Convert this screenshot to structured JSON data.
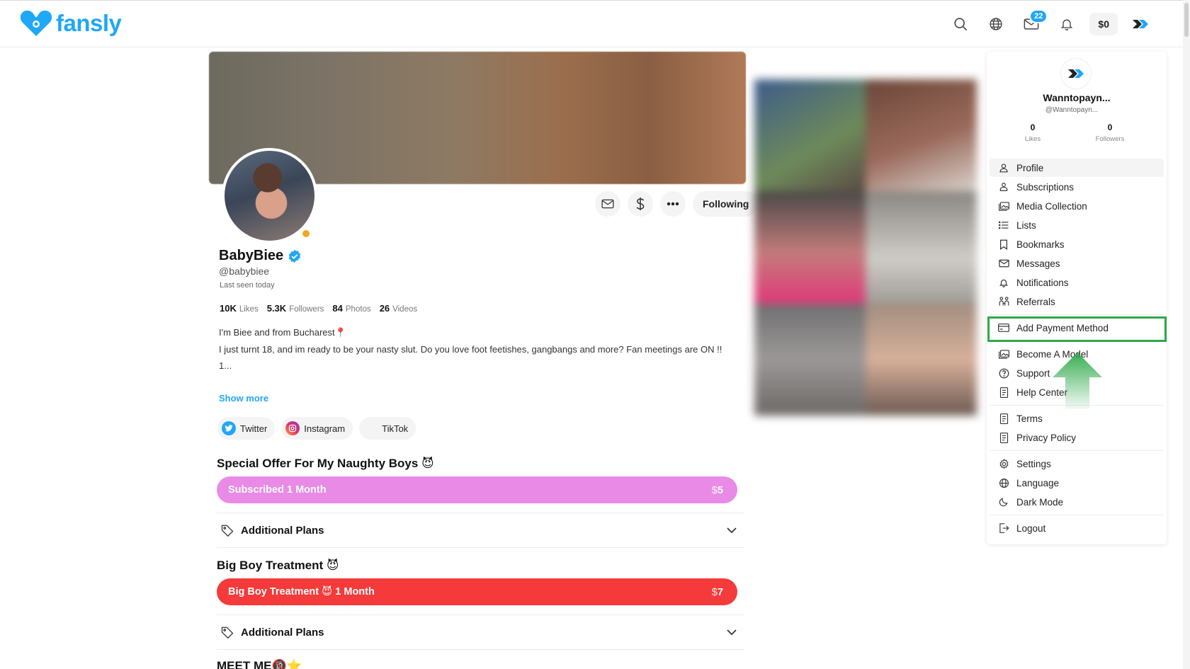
{
  "brand": {
    "name": "fansly",
    "color": "#1fa7f8"
  },
  "topbar": {
    "icons": [
      "search-icon",
      "globe-icon",
      "mail-icon",
      "bell-icon"
    ],
    "messages_badge": "22",
    "wallet": "$0"
  },
  "profile": {
    "display_name": "BabyBiee",
    "handle": "@babybiee",
    "last_seen": "Last seen today",
    "following_label": "Following",
    "stats": [
      {
        "value": "10K",
        "label": "Likes"
      },
      {
        "value": "5.3K",
        "label": "Followers"
      },
      {
        "value": "84",
        "label": "Photos"
      },
      {
        "value": "26",
        "label": "Videos"
      }
    ],
    "bio_lines": [
      "I'm Biee and from Bucharest📍",
      "I just turnt 18, and im ready to be your nasty slut. Do you love foot feetishes, gangbangs and more? Fan meetings are ON !!",
      "1..."
    ],
    "show_more": "Show more",
    "socials": [
      {
        "label": "Twitter"
      },
      {
        "label": "Instagram"
      },
      {
        "label": "TikTok"
      }
    ]
  },
  "offers": [
    {
      "title": "Special Offer For My Naughty Boys 😈",
      "bar_label": "Subscribed 1 Month",
      "price_symbol": "$",
      "price": "5",
      "color": "#e98ae6",
      "plans_label": "Additional Plans"
    },
    {
      "title": "Big Boy Treatment 😈",
      "bar_label": "Big Boy Treatment 😈 1 Month",
      "price_symbol": "$",
      "price": "7",
      "color": "#f43a3a",
      "plans_label": "Additional Plans"
    }
  ],
  "next_section_title": "MEET ME🔞⭐",
  "menu": {
    "user_name": "Wanntopayn...",
    "user_handle": "@Wanntopayn...",
    "likes": {
      "value": "0",
      "label": "Likes"
    },
    "followers": {
      "value": "0",
      "label": "Followers"
    },
    "items": [
      {
        "label": "Profile",
        "icon": "user-icon"
      },
      {
        "label": "Subscriptions",
        "icon": "subscriptions-icon"
      },
      {
        "label": "Media Collection",
        "icon": "media-collection-icon"
      },
      {
        "label": "Lists",
        "icon": "list-icon"
      },
      {
        "label": "Bookmarks",
        "icon": "bookmark-icon"
      },
      {
        "label": "Messages",
        "icon": "mail-icon"
      },
      {
        "label": "Notifications",
        "icon": "bell-icon"
      },
      {
        "label": "Referrals",
        "icon": "referrals-icon"
      },
      {
        "label": "Add Payment Method",
        "icon": "credit-card-icon"
      },
      {
        "label": "Become A Model",
        "icon": "model-icon"
      },
      {
        "label": "Support",
        "icon": "help-circle-icon"
      },
      {
        "label": "Help Center",
        "icon": "document-icon"
      },
      {
        "label": "Terms",
        "icon": "document-icon"
      },
      {
        "label": "Privacy Policy",
        "icon": "document-icon"
      },
      {
        "label": "Settings",
        "icon": "gear-icon"
      },
      {
        "label": "Language",
        "icon": "globe-icon"
      },
      {
        "label": "Dark Mode",
        "icon": "moon-icon"
      },
      {
        "label": "Logout",
        "icon": "logout-icon"
      }
    ],
    "highlight_color": "#2ea84a"
  }
}
